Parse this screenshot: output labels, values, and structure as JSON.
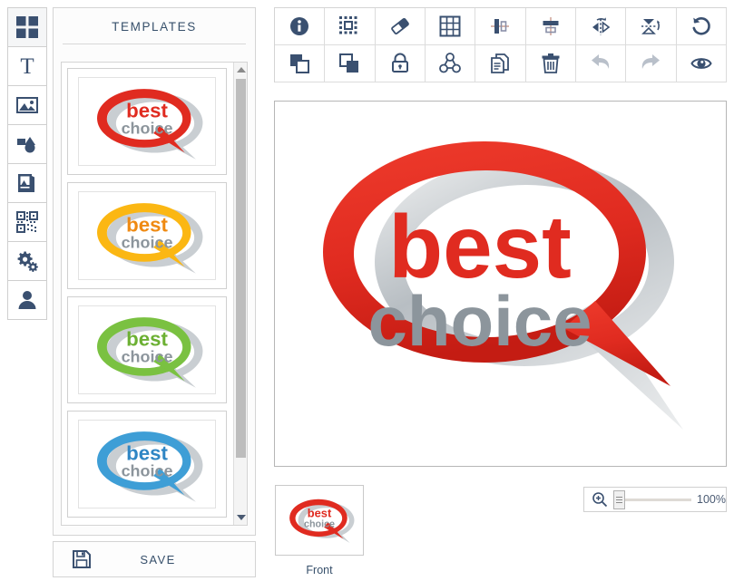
{
  "app": {
    "accent": "#37506b",
    "icon_color": "#3a5070",
    "disabled_color": "#b9c0ca"
  },
  "tool_rail": {
    "items": [
      {
        "name": "templates",
        "icon": "grid-squares-icon",
        "active": true
      },
      {
        "name": "text",
        "icon": "text-icon",
        "active": false
      },
      {
        "name": "image",
        "icon": "image-icon",
        "active": false
      },
      {
        "name": "shapes",
        "icon": "shapes-icon",
        "active": false
      },
      {
        "name": "gallery",
        "icon": "album-icon",
        "active": false
      },
      {
        "name": "qr-code",
        "icon": "qr-code-icon",
        "active": false
      },
      {
        "name": "settings",
        "icon": "gears-icon",
        "active": false
      },
      {
        "name": "account",
        "icon": "person-icon",
        "active": false
      }
    ]
  },
  "templates": {
    "title": "TEMPLATES",
    "items": [
      {
        "label": "best choice red",
        "word_top": "best",
        "word_bottom": "choice",
        "color": "#e02b20",
        "color_dark": "#b81d14"
      },
      {
        "label": "best choice yellow",
        "word_top": "best",
        "word_bottom": "choice",
        "color": "#fbb713",
        "color_dark": "#ef8a12"
      },
      {
        "label": "best choice green",
        "word_top": "best",
        "word_bottom": "choice",
        "color": "#7ac141",
        "color_dark": "#4f9b24"
      },
      {
        "label": "best choice blue",
        "word_top": "best",
        "word_bottom": "choice",
        "color": "#3e9ed6",
        "color_dark": "#1f6fae"
      }
    ],
    "scrollbar": {
      "up_arrow": "triangle-up-icon",
      "down_arrow": "triangle-down-icon"
    }
  },
  "save": {
    "label": "SAVE",
    "icon": "floppy-disk-icon"
  },
  "toolbar": {
    "rows": [
      [
        {
          "name": "info",
          "icon": "info-icon",
          "label": "Info",
          "disabled": false
        },
        {
          "name": "select-area",
          "icon": "marquee-select-icon",
          "label": "Select area",
          "disabled": false
        },
        {
          "name": "eraser",
          "icon": "eraser-icon",
          "label": "Eraser",
          "disabled": false
        },
        {
          "name": "grid",
          "icon": "grid-icon",
          "label": "Grid",
          "disabled": false
        },
        {
          "name": "align-vertical",
          "icon": "align-vertical-icon",
          "label": "Align vertical",
          "disabled": false
        },
        {
          "name": "align-horizontal",
          "icon": "align-horizontal-icon",
          "label": "Align horizontal",
          "disabled": false
        },
        {
          "name": "flip-horizontal",
          "icon": "flip-horizontal-icon",
          "label": "Flip horizontal",
          "disabled": false
        },
        {
          "name": "flip-vertical",
          "icon": "flip-vertical-icon",
          "label": "Flip vertical",
          "disabled": false
        },
        {
          "name": "reset-rotation",
          "icon": "rotate-reset-icon",
          "label": "Reset",
          "disabled": false
        }
      ],
      [
        {
          "name": "bring-to-front",
          "icon": "bring-to-front-icon",
          "label": "Bring to front",
          "disabled": false
        },
        {
          "name": "send-to-back",
          "icon": "send-to-back-icon",
          "label": "Send to back",
          "disabled": false
        },
        {
          "name": "lock",
          "icon": "lock-icon",
          "label": "Lock",
          "disabled": false
        },
        {
          "name": "group",
          "icon": "group-icon",
          "label": "Group",
          "disabled": false
        },
        {
          "name": "duplicate",
          "icon": "copy-pages-icon",
          "label": "Duplicate",
          "disabled": false
        },
        {
          "name": "delete",
          "icon": "trash-icon",
          "label": "Delete",
          "disabled": false
        },
        {
          "name": "undo",
          "icon": "undo-arrow-icon",
          "label": "Undo",
          "disabled": true
        },
        {
          "name": "redo",
          "icon": "redo-arrow-icon",
          "label": "Redo",
          "disabled": true
        },
        {
          "name": "preview",
          "icon": "eye-icon",
          "label": "Preview",
          "disabled": false
        }
      ]
    ]
  },
  "canvas": {
    "artwork": {
      "word_top": "best",
      "word_bottom": "choice",
      "bubble_color": "#e02b20",
      "bubble_color_dark": "#c21d14",
      "text_top_color": "#e02b20",
      "text_bottom_color": "#8c959c",
      "shadow_color": "#c6cacd"
    }
  },
  "page_thumb": {
    "label": "Front",
    "word_top": "best",
    "word_bottom": "choice",
    "color": "#e02b20"
  },
  "zoom": {
    "value": "100%",
    "icon": "zoom-in-icon",
    "slider_position_percent": 0
  }
}
